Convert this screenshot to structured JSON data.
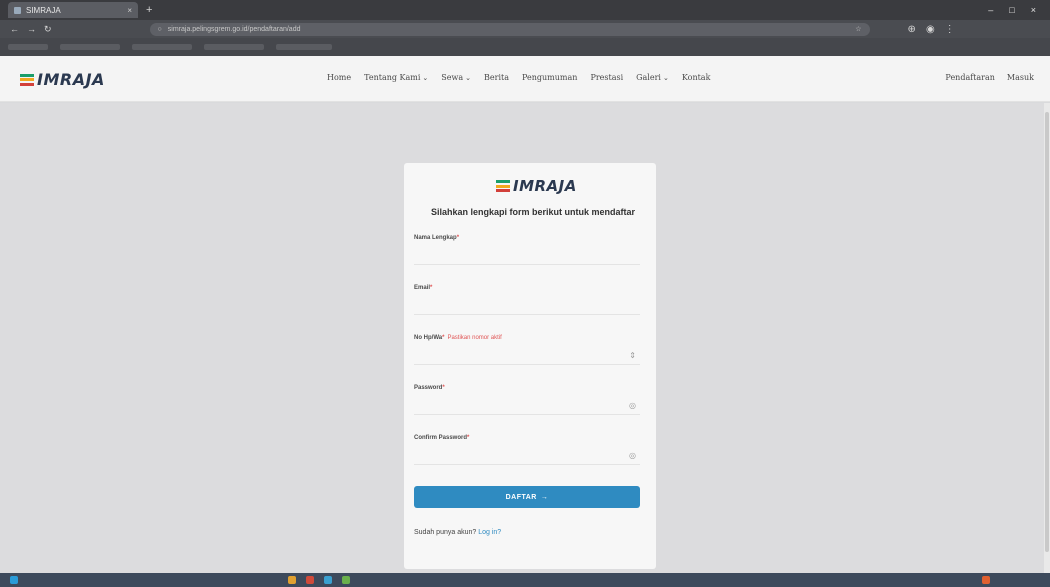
{
  "browser": {
    "tab_title": "SIMRAJA",
    "tab_close": "×",
    "new_tab": "+",
    "window_controls": [
      "–",
      "□",
      "×"
    ],
    "url": "simraja.pelingsgrem.go.id/pendaftaran/add"
  },
  "site": {
    "logo": "IMRAJA",
    "logo_colors": [
      "#1a9e6a",
      "#f0a81e",
      "#d2403a"
    ],
    "menu": [
      {
        "label": "Home",
        "caret": ""
      },
      {
        "label": "Tentang Kami",
        "caret": "⌄"
      },
      {
        "label": "Sewa",
        "caret": "⌄"
      },
      {
        "label": "Berita",
        "caret": ""
      },
      {
        "label": "Pengumuman",
        "caret": ""
      },
      {
        "label": "Prestasi",
        "caret": ""
      },
      {
        "label": "Galeri",
        "caret": "⌄"
      },
      {
        "label": "Kontak",
        "caret": ""
      }
    ],
    "right_links": {
      "register": "Pendaftaran",
      "login": "Masuk"
    }
  },
  "form": {
    "logo": "IMRAJA",
    "subtitle": "Silahkan lengkapi form berikut untuk mendaftar",
    "fields": {
      "nama": {
        "label": "Nama Lengkap",
        "required": "*"
      },
      "email": {
        "label": "Email",
        "required": "*"
      },
      "phone": {
        "label": "No Hp/Wa",
        "required": "*",
        "hint": "Pastikan nomor aktif"
      },
      "password": {
        "label": "Password",
        "required": "*"
      },
      "confirm": {
        "label": "Confirm Password",
        "required": "*"
      }
    },
    "submit_label": "DAFTAR",
    "submit_icon": "→",
    "login_prompt": "Sudah punya akun?",
    "login_link": "Log in?"
  },
  "accent_color": "#2f8bc1"
}
